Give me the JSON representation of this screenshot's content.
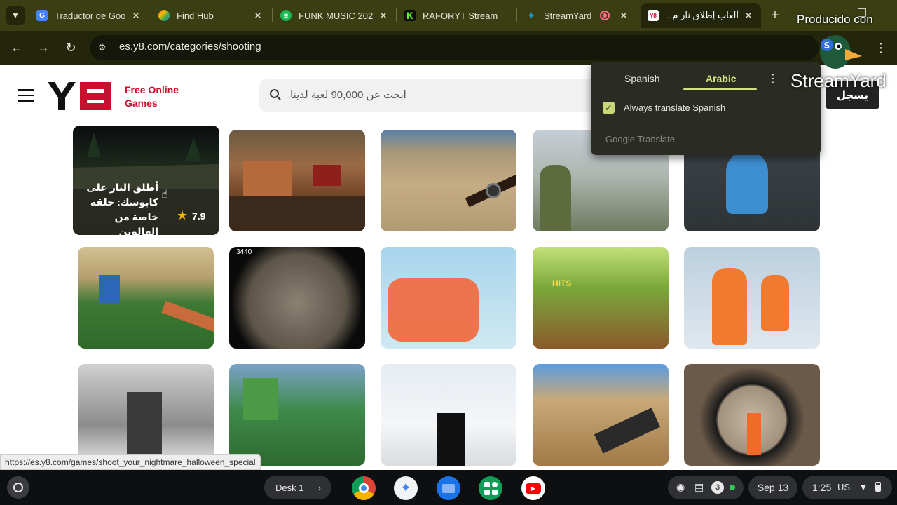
{
  "tabs": [
    {
      "title": "Traductor de Goo",
      "favicon_color": "#4285f4",
      "favicon_glyph": "G"
    },
    {
      "title": "Find Hub",
      "favicon_color": "#34a853",
      "favicon_glyph": "◆"
    },
    {
      "title": "FUNK MUSIC 202",
      "favicon_color": "#1db954",
      "favicon_glyph": "≋"
    },
    {
      "title": "RAFORYT Stream",
      "favicon_color": "#53fc18",
      "favicon_glyph": "K"
    },
    {
      "title": "StreamYard",
      "favicon_color": "#1d9bd1",
      "favicon_glyph": "✦"
    },
    {
      "title": "ألعاب إطلاق نار م...",
      "favicon_color": "#c8102e",
      "favicon_glyph": "Y8"
    }
  ],
  "toolbar": {
    "url": "es.y8.com/categories/shooting"
  },
  "watermark": {
    "produced_with": "Producido con",
    "brand": "StreamYard"
  },
  "site": {
    "logo_text_line1": "Free Online",
    "logo_text_line2": "Games",
    "search_placeholder": "ابحث عن 90,000 لعبة لدينا",
    "signup_label": "يسجل"
  },
  "translate_popup": {
    "tab_source": "Spanish",
    "tab_target": "Arabic",
    "always_translate_label": "Always translate Spanish",
    "always_translate_checked": true,
    "footer": "Google Translate"
  },
  "featured_game": {
    "title_line1": "أطلق النار على",
    "title_line2": "كابوسك: حلقة",
    "title_line3": "خاصة من الهالوين",
    "rating": "7.9"
  },
  "thumb_overlays": {
    "hits_text": "HITS",
    "score_text": "3440"
  },
  "status_bar": {
    "hover_url": "https://es.y8.com/games/shoot_your_nightmare_halloween_special"
  },
  "shelf": {
    "desk_label": "Desk 1",
    "notification_count": "3",
    "date": "Sep 13",
    "time": "1:25",
    "locale": "US"
  }
}
